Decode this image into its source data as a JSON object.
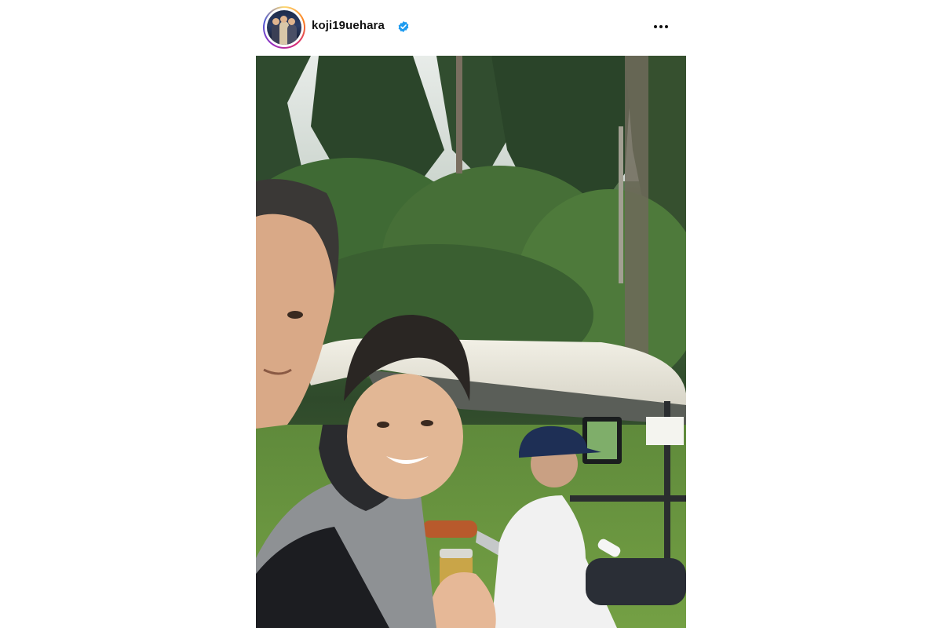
{
  "post": {
    "username": "koji19uehara",
    "verified": true,
    "icons": {
      "avatar": "profile-photo",
      "verified": "verified-badge-icon",
      "more": "more-options-icon"
    },
    "colors": {
      "verified_badge": "#1d9bf0",
      "story_ring": [
        "#feda75",
        "#fa7e1e",
        "#d62976",
        "#962fbf",
        "#4f5bd5"
      ]
    }
  }
}
